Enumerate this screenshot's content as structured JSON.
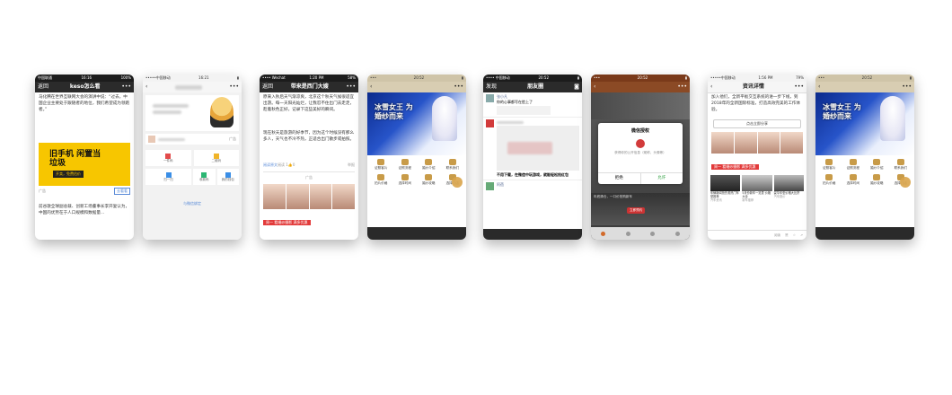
{
  "screens": [
    {
      "status": {
        "carrier": "中国联通",
        "time": "16:16",
        "battery": "100%"
      },
      "nav": {
        "back": "返回",
        "title": "keso怎么看",
        "more": "•••"
      },
      "paragraph": "马化腾在世界互联网大会的演讲中说：“过去，中国企业主要处于跟随者的地位，我们希望成为领跑者。”",
      "ad": {
        "headline": "旧手机 闲置当垃圾",
        "badge": "开卖，免费估价",
        "label": "广告",
        "button": "去看看"
      },
      "paragraph2": "前谷歌全球副总裁、创新工场董事长李开复认为，中国的优势在于人口规模和数据量..."
    },
    {
      "status": {
        "carrier": "•••••中国移动",
        "time": "16:21"
      },
      "nav": {
        "back": "‹",
        "more": "•••"
      },
      "shop_label": "广告",
      "tiles": [
        "一件码",
        "二维码",
        "扫一扫",
        "收款码",
        "我的钱包"
      ],
      "footer": "与微信绑定"
    },
    {
      "status": {
        "carrier": "•••• Wechat",
        "time": "1:20 PM",
        "battery": "58%"
      },
      "nav": {
        "back": "返回",
        "title": "带来是西门大嫂",
        "more": "•••"
      },
      "paragraph": "原来入秋后天气渐凉爽，北京这个秋天气候很适宜出游。每一天阳光灿烂，让我忍不住出门去走走，趁着秋色正好，记录下这些美好的瞬间。",
      "paragraph2": "现在秋天是旅游的好季节，因为这个时候没有那么多人，天气也不冷不热，正适合出门散步或拍照。",
      "links": {
        "read": "阅读原文",
        "count": "阅读 1",
        "like": "0",
        "report": "举报"
      },
      "ad_label": "广告",
      "ad_caption": "周一 看婚纱摄影 满多优惠"
    },
    {
      "status": {
        "time": "20:52"
      },
      "nav": {
        "more": "•••"
      },
      "banner_title": "冰雪女王 为婚纱而来",
      "grid": [
        "证照客片",
        "证照流程",
        "婚纱介绍",
        "联系我们",
        "拍片价格",
        "选择时间",
        "婚纱攻略",
        "选择门店"
      ]
    },
    {
      "status": {
        "carrier": "•••• 中国移动",
        "time": "20:52"
      },
      "nav": {
        "back": "发现",
        "title": "朋友圈"
      },
      "post_name": "张小凡",
      "post_text": "你的心事都写在脸上了",
      "post2": "不用下载，在微信中玩游戏，就能轻松抢红包",
      "post3_name": "阿蓓"
    },
    {
      "status": {
        "time": "20:52"
      },
      "nav": {
        "more": "•••"
      },
      "dialog": {
        "title": "微信授权",
        "text": "获得你的公开信息（昵称、头像等）",
        "reject": "拒绝",
        "allow": "允许"
      },
      "bottom_text": "年底清仓，一口价抢购新车",
      "bottom_tag": "立即预约"
    },
    {
      "status": {
        "carrier": "•••••中国移动",
        "time": "1:56 PM",
        "battery": "79%"
      },
      "nav": {
        "back": "‹",
        "title": "资讯详情",
        "more": "•••"
      },
      "paragraph": "加入他们，全新平板交互系统的进一步下线，到2018年的全新国际标准，打造高效完美的工作体验。",
      "button": "点击立即分享",
      "ad_caption": "周一 看婚纱摄影 满多优惠",
      "news": [
        {
          "title": "车辆新闻抢先看热门车型推荐",
          "tag": "汽车资讯"
        },
        {
          "title": "5月份新车一览表 价格大全",
          "tag": "新车推荐"
        },
        {
          "title": "豪华车型价格大比拼",
          "tag": "汽车报价"
        }
      ],
      "footer": {
        "count": "阅读",
        "like": "赞"
      }
    },
    {
      "status": {
        "time": "20:52"
      },
      "nav": {
        "more": "•••"
      },
      "banner_title": "冰雪女王 为婚纱而来",
      "grid": [
        "证照客片",
        "证照流程",
        "婚纱介绍",
        "联系我们",
        "拍片价格",
        "选择时间",
        "婚纱攻略",
        "选择门店"
      ]
    }
  ]
}
